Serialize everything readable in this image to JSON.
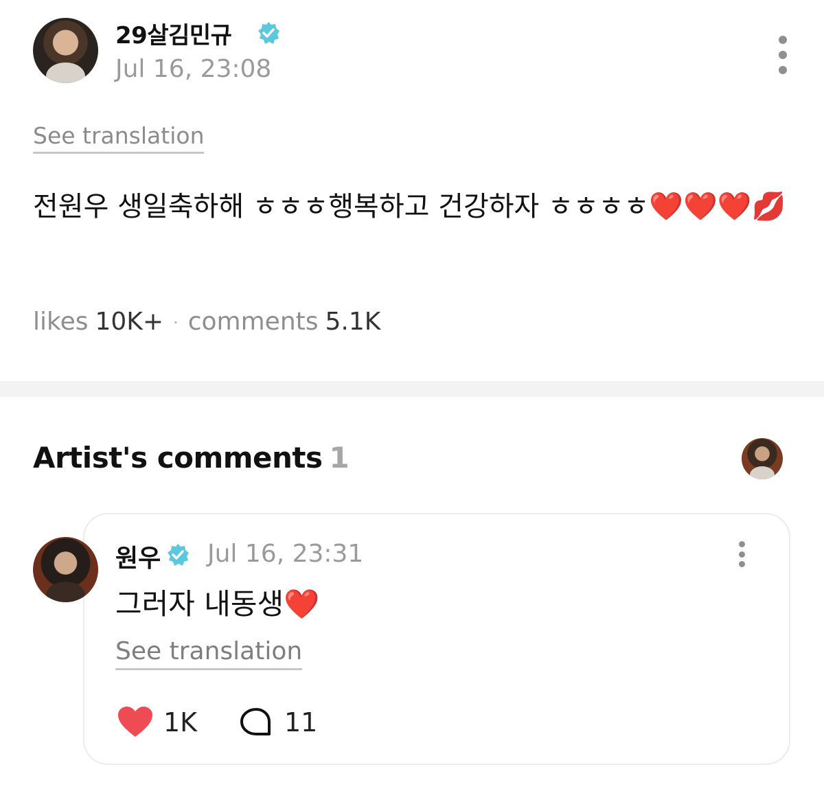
{
  "post": {
    "author": "29살김민규",
    "time": "Jul 16, 23:08",
    "see_translation": "See translation",
    "text": "전원우 생일축하해 ㅎㅎㅎ행복하고 건강하자 ㅎㅎㅎㅎ❤️❤️❤️💋",
    "likes_label": "likes",
    "likes_value": "10K+",
    "separator": "·",
    "comments_label": "comments",
    "comments_value": "5.1K"
  },
  "artist_comments": {
    "title": "Artist's comments",
    "count": "1"
  },
  "comment": {
    "author": "원우",
    "time": "Jul 16, 23:31",
    "text": "그러자 내동생❤️",
    "see_translation": "See translation",
    "likes": "1K",
    "replies": "11"
  },
  "colors": {
    "verified": "#5bc8dd",
    "heart": "#ef4b55",
    "muted_text": "#9a9a9a"
  },
  "icons": {
    "verified": "verified-badge-icon",
    "more": "more-vertical-icon",
    "like": "heart-icon",
    "reply": "comment-bubble-icon"
  }
}
